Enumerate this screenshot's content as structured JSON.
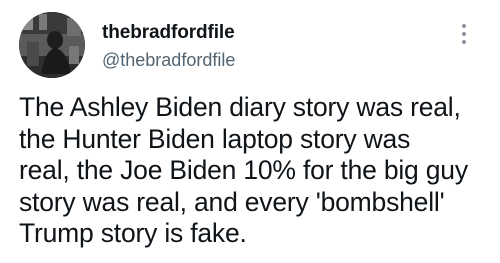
{
  "tweet": {
    "author": {
      "display_name": "thebradfordfile",
      "handle": "@thebradfordfile",
      "avatar_icon": "profile-photo"
    },
    "menu_icon": "more-options-icon",
    "text": "The Ashley Biden diary story was real,\nthe Hunter Biden laptop story was\nreal, the Joe Biden 10% for the big guy\nstory was real, and every 'bombshell'\nTrump story is fake."
  }
}
